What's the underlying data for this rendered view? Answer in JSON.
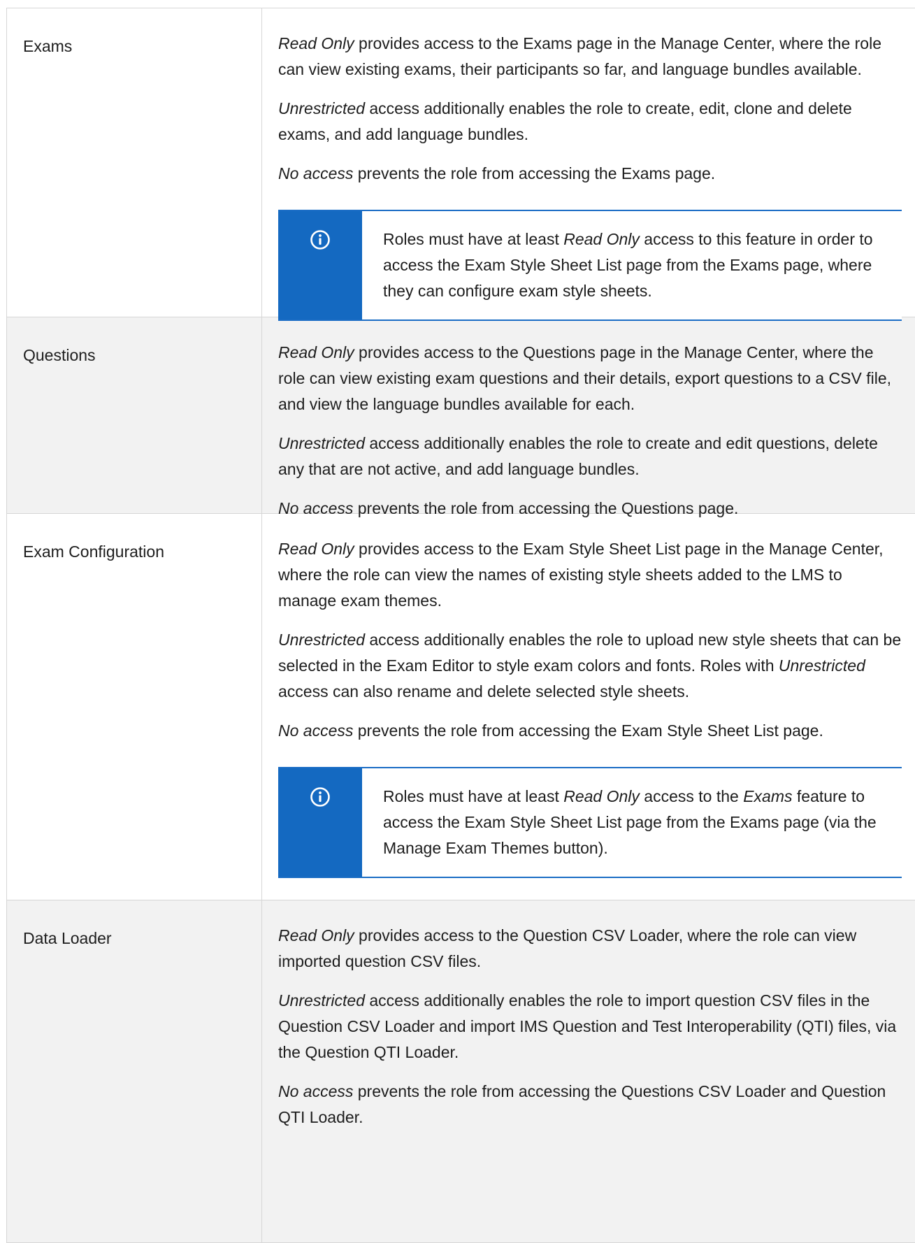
{
  "rows": [
    {
      "feature": "Exams",
      "read_only": {
        "em": "Read Only",
        "text": " provides access to the Exams page in the Manage Center, where the role can view existing exams, their participants so far, and language bundles available."
      },
      "unrestricted": {
        "em": "Unrestricted",
        "text": " access additionally enables the role to create, edit, clone and delete exams, and add language bundles."
      },
      "no_access": {
        "em": "No access",
        "text": " prevents the role from accessing the Exams page."
      },
      "note": {
        "pre": "Roles must have at least ",
        "em": "Read Only",
        "post": " access to this feature in order to access the Exam Style Sheet List page from the Exams page, where they can configure exam style sheets."
      }
    },
    {
      "feature": "Questions",
      "read_only": {
        "em": "Read Only",
        "text": " provides access to the Questions page in the Manage Center, where the role can view existing exam questions and their details, export questions to a CSV file, and view the language bundles available for each."
      },
      "unrestricted": {
        "em": "Unrestricted",
        "text": " access additionally enables the role to create and edit questions, delete any that are not active, and add language bundles."
      },
      "no_access": {
        "em": "No access",
        "text": " prevents the role from accessing the Questions page."
      }
    },
    {
      "feature": "Exam Configuration",
      "read_only": {
        "em": "Read Only",
        "text": " provides access to the Exam Style Sheet List page in the Manage Center, where the role can view the names of existing style sheets added to the LMS to manage exam themes."
      },
      "unrestricted": {
        "em": "Unrestricted",
        "text": " access additionally enables the role to upload new style sheets that can be selected in the Exam Editor to style exam colors and fonts. Roles with ",
        "em2": "Unrestricted",
        "text2": " access can also rename and delete selected style sheets."
      },
      "no_access": {
        "em": "No access",
        "text": " prevents the role from accessing the Exam Style Sheet List page."
      },
      "note": {
        "pre": "Roles must have at least ",
        "em": "Read Only",
        "mid": " access to the ",
        "em2": "Exams",
        "post": " feature to access the Exam Style Sheet List page from the Exams page (via the Manage Exam Themes button)."
      }
    },
    {
      "feature": "Data Loader",
      "read_only": {
        "em": "Read Only",
        "text": " provides access to the Question CSV Loader, where the role can view imported question CSV files."
      },
      "unrestricted": {
        "em": "Unrestricted",
        "text": " access additionally enables the role to import question CSV files in the Question CSV Loader and import IMS Question and Test Interoperability (QTI) files, via the Question QTI Loader."
      },
      "no_access": {
        "em": "No access",
        "text": " prevents the role from accessing the Questions CSV Loader and Question QTI Loader."
      }
    }
  ],
  "colors": {
    "note_accent": "#1469c1",
    "row_shade": "#f2f2f2",
    "border": "#d6d6d6"
  },
  "icons": {
    "note": "info-circle-icon"
  }
}
